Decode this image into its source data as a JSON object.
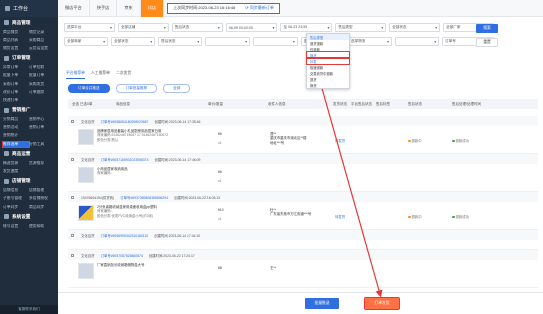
{
  "sidebar": {
    "title": "工作台",
    "groups": [
      {
        "title": "商品管理",
        "rows": [
          [
            "商品铺货",
            "铺货记录"
          ],
          [
            "商品列表",
            "采购商品"
          ],
          [
            "铺货设置",
            "云货运设置"
          ]
        ]
      },
      {
        "title": "订单管理",
        "rows": [
          [
            "异常订单",
            "订单拉取"
          ],
          [
            "批量下单",
            "批量订单"
          ],
          [
            "采购订单",
            "采购发货"
          ],
          [
            "改价订单",
            "订单跟踪"
          ],
          [
            "快递打单",
            ""
          ]
        ]
      },
      {
        "title": "营销推广",
        "rows": [
          [
            "分销商品",
            "营销中心"
          ],
          [
            "营销活动",
            "营销订单"
          ],
          [
            "营销统计",
            ""
          ],
          [
            "推荐选单",
            "分销工具"
          ]
        ]
      },
      {
        "title": "商品运营",
        "rows": [
          [
            "精选货源",
            "货源推荐"
          ],
          [
            "发货速度",
            ""
          ]
        ]
      },
      {
        "title": "店铺管理",
        "rows": [
          [
            "店铺信息",
            "店铺管理"
          ],
          [
            "子账号管理",
            "多店铺授权"
          ],
          [
            "订单同步",
            "商品同步"
          ]
        ]
      },
      {
        "title": "系统设置",
        "rows": [
          [
            "账号设置",
            "使用帮助"
          ]
        ]
      }
    ],
    "footer": "客服联系我们"
  },
  "platform_tabs": [
    "微店平台",
    "快手店",
    "京东",
    "抖店"
  ],
  "active_platform_tab": 3,
  "sync": {
    "text": "上次同步时间:2023-06-23 16:16:46",
    "link": "同步最新订单"
  },
  "filters": {
    "row1": [
      "选择平台",
      "全部店铺",
      "售后状态",
      "08-09 00:00:00",
      "至 06-23 23:59",
      "售后类型",
      "全部状态",
      "全部厂家"
    ],
    "row2": [
      "全部商家",
      "全部状态",
      "售后状态",
      "",
      "",
      "退款类型",
      "选择物流",
      "",
      "订单号"
    ],
    "search_btn": "搜索",
    "reset_btn": "重置"
  },
  "dropdown": {
    "items": [
      "售后类型",
      "退货退款",
      "仅退款",
      "换货",
      "补发",
      "极速退款",
      "交易收货中退款",
      "退货",
      "换货"
    ],
    "selected": 0,
    "highlighted": [
      3,
      4
    ]
  },
  "order_tabs": [
    "平台推荐单",
    "人工推荐单",
    "二次发货"
  ],
  "sub_tabs": [
    "订单合并推送",
    "订单批量推荐",
    "全部"
  ],
  "table_head": [
    "全选",
    "已选0单",
    "商品信息",
    "单价/数量",
    "收件人信息",
    "发货状态",
    "平台售后状态",
    "售后标签",
    "售后状态",
    "售后处理/处理时间"
  ],
  "orders": [
    {
      "shop": "文化百货",
      "id": "订单号#6938654180298023687",
      "time": "创建时间:2023-06-14 17:35:46",
      "title1": "品牌家居用品套装小礼品厨房用品居家日用",
      "title2": "商家编码:5146246715067 17 51462467150672",
      "title3": "颜色分类:默认",
      "price": "¥6",
      "qty": "x1",
      "addr1": "谭**",
      "addr2": "重庆市重庆市渝北区**楼",
      "addr3": "地址***号",
      "buyer": "待发货",
      "st1": "退款中",
      "st2": "退款成功"
    },
    {
      "shop": "文化百货",
      "id": "订单号#6937165931023556374",
      "time": "创建时间:2023-06-14 17:46:09",
      "title1": "小商品居家收纳用品",
      "title2": "商家编码:-",
      "title3": "",
      "price": "¥6",
      "qty": "x1",
      "addr1": "",
      "addr2": "",
      "addr3": "",
      "buyer": "",
      "st1": "",
      "st2": ""
    },
    {
      "shop": "19476654194(供货商)",
      "id": "订单号#6937089808385696294",
      "time": "创建时间:2023-06-22 16:03:13",
      "title1": "2分负者箱收纳盒家用桌面收纳盒pp塑料",
      "title2": "商家编码:-",
      "title3": "颜色分类:优质PVC收纳盒小号(约3米)",
      "price": "¥10",
      "qty": "x1",
      "addr1": "杜**",
      "addr2": "广东省东莞市万江街道***号",
      "addr3": "",
      "buyer": "待发货",
      "st1": "退款中",
      "st2": "退款成功"
    },
    {
      "shop": "文化百货",
      "id": "订单号#6936995342310180110",
      "time": "创建时间:2023-06-14 17:44:10",
      "title1": "",
      "title2": "",
      "title3": "",
      "price": "",
      "qty": "",
      "addr1": "",
      "addr2": "",
      "addr3": "",
      "buyer": "",
      "st1": "",
      "st2": ""
    },
    {
      "shop": "文化百货",
      "id": "订单号#6937087826860874",
      "time": "创建时间:2023-06-22 17:24:17",
      "title1": "厂家直销加长收纳箱储物盒大号",
      "title2": "",
      "title3": "",
      "price": "¥8",
      "qty": "",
      "addr1": "王**",
      "addr2": "",
      "addr3": "",
      "buyer": "",
      "st1": "",
      "st2": ""
    }
  ],
  "bottom": {
    "btn1": "批量推送",
    "btn2": "打单发货"
  },
  "colors": {
    "accent": "#2f6fe0",
    "orange": "#ff8c1a",
    "highlight": "#e53935"
  }
}
